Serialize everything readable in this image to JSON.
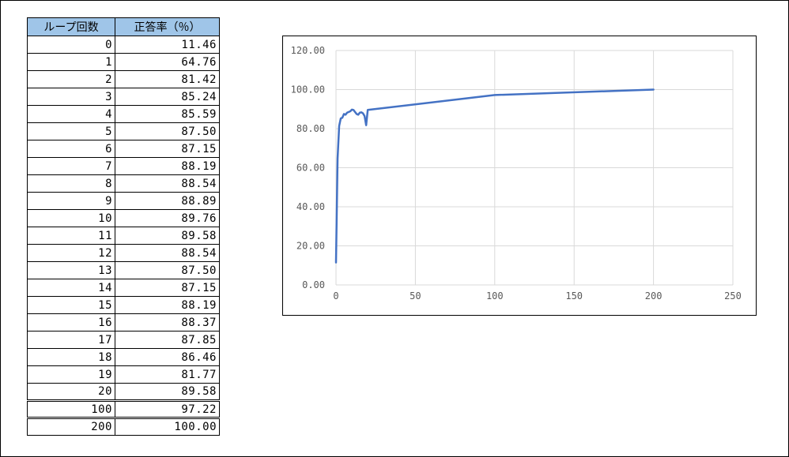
{
  "table": {
    "headers": [
      "ループ回数",
      "正答率（％）"
    ],
    "rows": [
      [
        "0",
        "11.46"
      ],
      [
        "1",
        "64.76"
      ],
      [
        "2",
        "81.42"
      ],
      [
        "3",
        "85.24"
      ],
      [
        "4",
        "85.59"
      ],
      [
        "5",
        "87.50"
      ],
      [
        "6",
        "87.15"
      ],
      [
        "7",
        "88.19"
      ],
      [
        "8",
        "88.54"
      ],
      [
        "9",
        "88.89"
      ],
      [
        "10",
        "89.76"
      ],
      [
        "11",
        "89.58"
      ],
      [
        "12",
        "88.54"
      ],
      [
        "13",
        "87.50"
      ],
      [
        "14",
        "87.15"
      ],
      [
        "15",
        "88.19"
      ],
      [
        "16",
        "88.37"
      ],
      [
        "17",
        "87.85"
      ],
      [
        "18",
        "86.46"
      ],
      [
        "19",
        "81.77"
      ],
      [
        "20",
        "89.58"
      ],
      [
        "100",
        "97.22"
      ],
      [
        "200",
        "100.00"
      ]
    ]
  },
  "chart_data": {
    "type": "line",
    "x": [
      0,
      1,
      2,
      3,
      4,
      5,
      6,
      7,
      8,
      9,
      10,
      11,
      12,
      13,
      14,
      15,
      16,
      17,
      18,
      19,
      20,
      100,
      200
    ],
    "series": [
      {
        "values": [
          11.46,
          64.76,
          81.42,
          85.24,
          85.59,
          87.5,
          87.15,
          88.19,
          88.54,
          88.89,
          89.76,
          89.58,
          88.54,
          87.5,
          87.15,
          88.19,
          88.37,
          87.85,
          86.46,
          81.77,
          89.58,
          97.22,
          100.0
        ],
        "color": "#4472c4"
      }
    ],
    "xlim": [
      0,
      250
    ],
    "ylim": [
      0,
      120
    ],
    "x_ticks": [
      "0",
      "50",
      "100",
      "150",
      "200",
      "250"
    ],
    "y_ticks": [
      "0.00",
      "20.00",
      "40.00",
      "60.00",
      "80.00",
      "100.00",
      "120.00"
    ],
    "grid": true,
    "legend": "none",
    "grid_color": "#d9d9d9"
  }
}
